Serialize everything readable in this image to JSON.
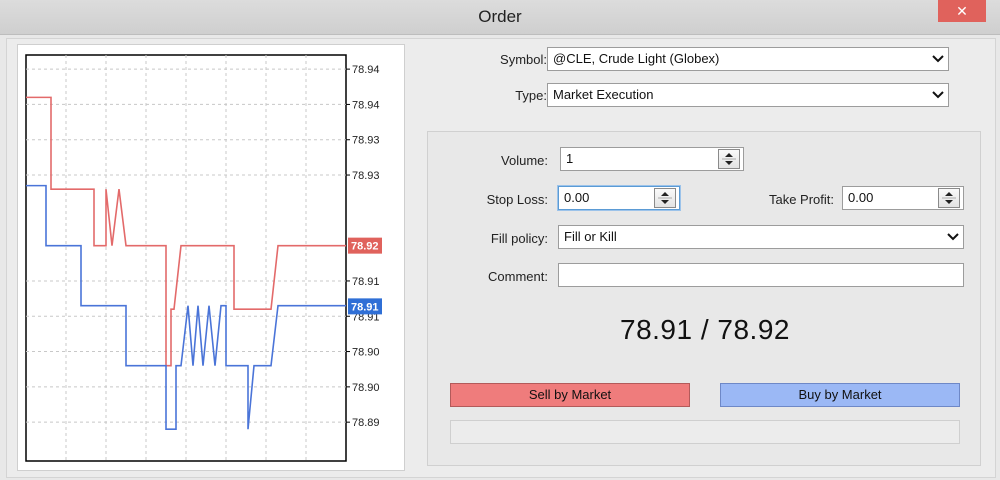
{
  "window": {
    "title": "Order",
    "close_label": "✕"
  },
  "chart_data": {
    "type": "line",
    "ylim": [
      78.887,
      78.9445
    ],
    "price_labels": [
      {
        "text": "78.94",
        "y": 78.9425
      },
      {
        "text": "78.94",
        "y": 78.9375
      },
      {
        "text": "78.93",
        "y": 78.9325
      },
      {
        "text": "78.93",
        "y": 78.9275
      },
      {
        "text": "78.91",
        "y": 78.9125
      },
      {
        "text": "78.91",
        "y": 78.9075
      },
      {
        "text": "78.90",
        "y": 78.9025
      },
      {
        "text": "78.90",
        "y": 78.8975
      },
      {
        "text": "78.89",
        "y": 78.8925
      }
    ],
    "markers": [
      {
        "text": "78.92",
        "y": 78.9175,
        "color": "#e0625c"
      },
      {
        "text": "78.91",
        "y": 78.9089,
        "color": "#2f6fd6"
      }
    ],
    "series": [
      {
        "color": "#e36a6a",
        "points": [
          [
            0,
            78.9385
          ],
          [
            25,
            78.9385
          ],
          [
            25,
            78.9255
          ],
          [
            68,
            78.9255
          ],
          [
            68,
            78.9175
          ],
          [
            80,
            78.9175
          ],
          [
            80,
            78.9255
          ],
          [
            86,
            78.9175
          ],
          [
            93,
            78.9255
          ],
          [
            100,
            78.9175
          ],
          [
            100,
            78.9175
          ],
          [
            140,
            78.9175
          ],
          [
            140,
            78.9005
          ],
          [
            145,
            78.9005
          ],
          [
            145,
            78.9085
          ],
          [
            148,
            78.9085
          ],
          [
            155,
            78.9175
          ],
          [
            208,
            78.9175
          ],
          [
            208,
            78.9085
          ],
          [
            245,
            78.9085
          ],
          [
            252,
            78.9175
          ],
          [
            320,
            78.9175
          ]
        ]
      },
      {
        "color": "#4a74d8",
        "points": [
          [
            0,
            78.926
          ],
          [
            20,
            78.926
          ],
          [
            20,
            78.9175
          ],
          [
            55,
            78.9175
          ],
          [
            55,
            78.909
          ],
          [
            100,
            78.909
          ],
          [
            100,
            78.9005
          ],
          [
            140,
            78.9005
          ],
          [
            140,
            78.8915
          ],
          [
            150,
            78.8915
          ],
          [
            150,
            78.9005
          ],
          [
            155,
            78.9005
          ],
          [
            162,
            78.909
          ],
          [
            167,
            78.9005
          ],
          [
            172,
            78.909
          ],
          [
            177,
            78.9005
          ],
          [
            183,
            78.909
          ],
          [
            189,
            78.9005
          ],
          [
            195,
            78.909
          ],
          [
            200,
            78.909
          ],
          [
            200,
            78.9005
          ],
          [
            222,
            78.9005
          ],
          [
            222,
            78.8915
          ],
          [
            228,
            78.9005
          ],
          [
            245,
            78.9005
          ],
          [
            252,
            78.909
          ],
          [
            320,
            78.909
          ]
        ]
      }
    ]
  },
  "form": {
    "symbol_label": "Symbol:",
    "symbol_value": "@CLE, Crude Light (Globex)",
    "type_label": "Type:",
    "type_value": "Market Execution",
    "volume_label": "Volume:",
    "volume_value": "1",
    "stop_loss_label": "Stop Loss:",
    "stop_loss_value": "0.00",
    "take_profit_label": "Take Profit:",
    "take_profit_value": "0.00",
    "fill_policy_label": "Fill policy:",
    "fill_policy_value": "Fill or Kill",
    "comment_label": "Comment:",
    "comment_value": ""
  },
  "quote": {
    "text": "78.91 / 78.92"
  },
  "buttons": {
    "sell": "Sell by Market",
    "buy": "Buy by Market"
  },
  "progress": {
    "fraction": 0
  },
  "icons": {
    "dropdown": "chevron-down-icon",
    "spin_up": "arrow-up-icon",
    "spin_down": "arrow-down-icon",
    "close": "close-icon"
  }
}
